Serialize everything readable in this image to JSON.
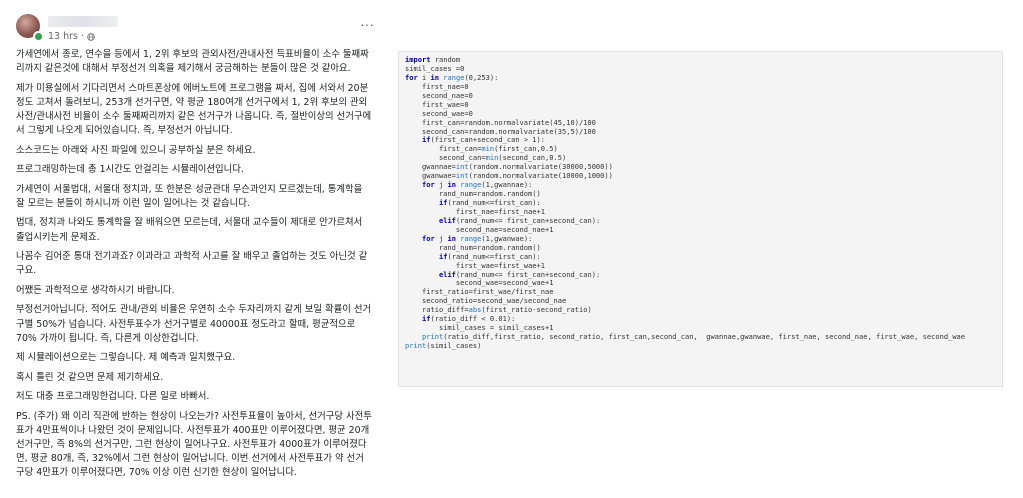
{
  "post": {
    "time": "13 hrs",
    "more_label": "···",
    "paragraphs": [
      "가세연에서 종로, 연수을 등에서 1, 2위 후보의 관외사전/관내사전 득표비율이 소수 둘째짜리까지 같은것에 대해서 부정선거 의혹을 제기해서 궁금해하는 분들이 많은 것 같아요.",
      "제가 미용실에서 기다리면서 스마트폰상에 에버노트에 프로그램을 짜서, 집에 서와서 20분정도 고쳐서 돌려보니, 253개 선거구면, 약 평균 180여개 선거구에서 1, 2위 후보의 관외사전/관내사전 비율이 소수 둘째짜리까지 같은 선거구가 나옵니다. 즉, 절반이상의 선거구에서 그렇게 나오게 되어있습니다. 즉, 부정선거 아닙니다.",
      "소스코드는 아래와 사진 파일에 있으니 공부하실 분은 하세요.",
      "프로그래밍하는데 총 1시간도 안걸리는 시뮬레이션입니다.",
      "가세연이 서울법대, 서울대 정치과, 또 한분은 성균관대 무슨과인지 모르겠는데, 통계학을 잘 모르는 분들이 하시니까 이런 일이 일어나는 것 같습니다.",
      "법대, 정치과 나와도 통계학을 잘 배워으면 모르는데, 서울대 교수들이 제대로 안가르쳐서 졸업시키는게 문제죠.",
      "나꼼수 김어준 통대 전기과죠? 이과라고 과학적 사고를 잘 배우고 졸업하는 것도 아닌것 같구요.",
      "어쨌든 과학적으로 생각하시기 바랍니다.",
      "부정선거아닙니다. 적어도 관내/관외 비율은 우연히 소수 두자리까지 같게 보일 확률이 선거구별 50%가 넘습니다. 사전투표수가 선거구별로 40000표 정도라고 할때, 평균적으로 70% 가까이 됩니다. 즉, 다른게 이상한겁니다.",
      "제 시뮬레이션으로는 그렇습니다. 제 예측과 일치했구요.",
      "혹시 틀린 것 같으면 문제 제기하세요.",
      "저도 대충 프로그래밍한겁니다. 다른 일로 바빠서.",
      "PS. (주가) 왜 이리 직관에 반하는 현상이 나오는가? 사전투표율이 높아서, 선거구당 사전투표가 4만표씩이나 나왔던 것이 문제입니다. 사전투표가 400표만 이루어졌다면, 평균 20개 선거구만, 즉 8%의 선거구만, 그런 현상이 일어나구요. 사전투표가 4000표가 이루어졌다면, 평균 80개, 즉, 32%에서 그런 현상이 일어납니다. 이번 선거에서 사전투표가 약 선거구당 4만표가 이루어졌다면, 70% 이상 이런 신기한 현상이 일어납니다."
    ]
  },
  "code": {
    "lines": [
      "import random",
      "simil_cases =0",
      "for i in range(0,253):",
      "    first_nae=0",
      "    second_nae=0",
      "    first_wae=0",
      "    second_wae=0",
      "    first_can=random.normalvariate(45,10)/100",
      "    second_can=random.normalvariate(35,5)/100",
      "    if(first_can+second_can > 1):",
      "        first_can=min(first_can,0.5)",
      "        second_can=min(second_can,0.5)",
      "    gwannae=int(random.normalvariate(30000,5000))",
      "    gwanwae=int(random.normalvariate(10000,1000))",
      "    for j in range(1,gwannae):",
      "        rand_num=random.random()",
      "        if(rand_num<=first_can):",
      "            first_nae=first_nae+1",
      "        elif(rand_num<= first_can+second_can):",
      "            second_nae=second_nae+1",
      "    for j in range(1,gwanwae):",
      "        rand_num=random.random()",
      "        if(rand_num<=first_can):",
      "            first_wae=first_wae+1",
      "        elif(rand_num<= first_can+second_can):",
      "            second_wae=second_wae+1",
      "    first_ratio=first_wae/first_nae",
      "    second_ratio=second_wae/second_nae",
      "    ratio_diff=abs(first_ratio-second_ratio)",
      "    if(ratio_diff < 0.01):",
      "        simil_cases = simil_cases+1",
      "    print(ratio_diff,first_ratio, second_ratio, first_can,second_can,  gwannae,gwanwae, first_nae, second_nae, first_wae, second_wae",
      "print(simil_cases)"
    ]
  },
  "icons": {
    "globe": "globe-icon",
    "more": "more-horizontal-icon"
  },
  "colors": {
    "keyword": "#0000b0",
    "builtin": "#1a73c8",
    "online": "#31a24c",
    "code_bg": "#f4f4f4"
  }
}
